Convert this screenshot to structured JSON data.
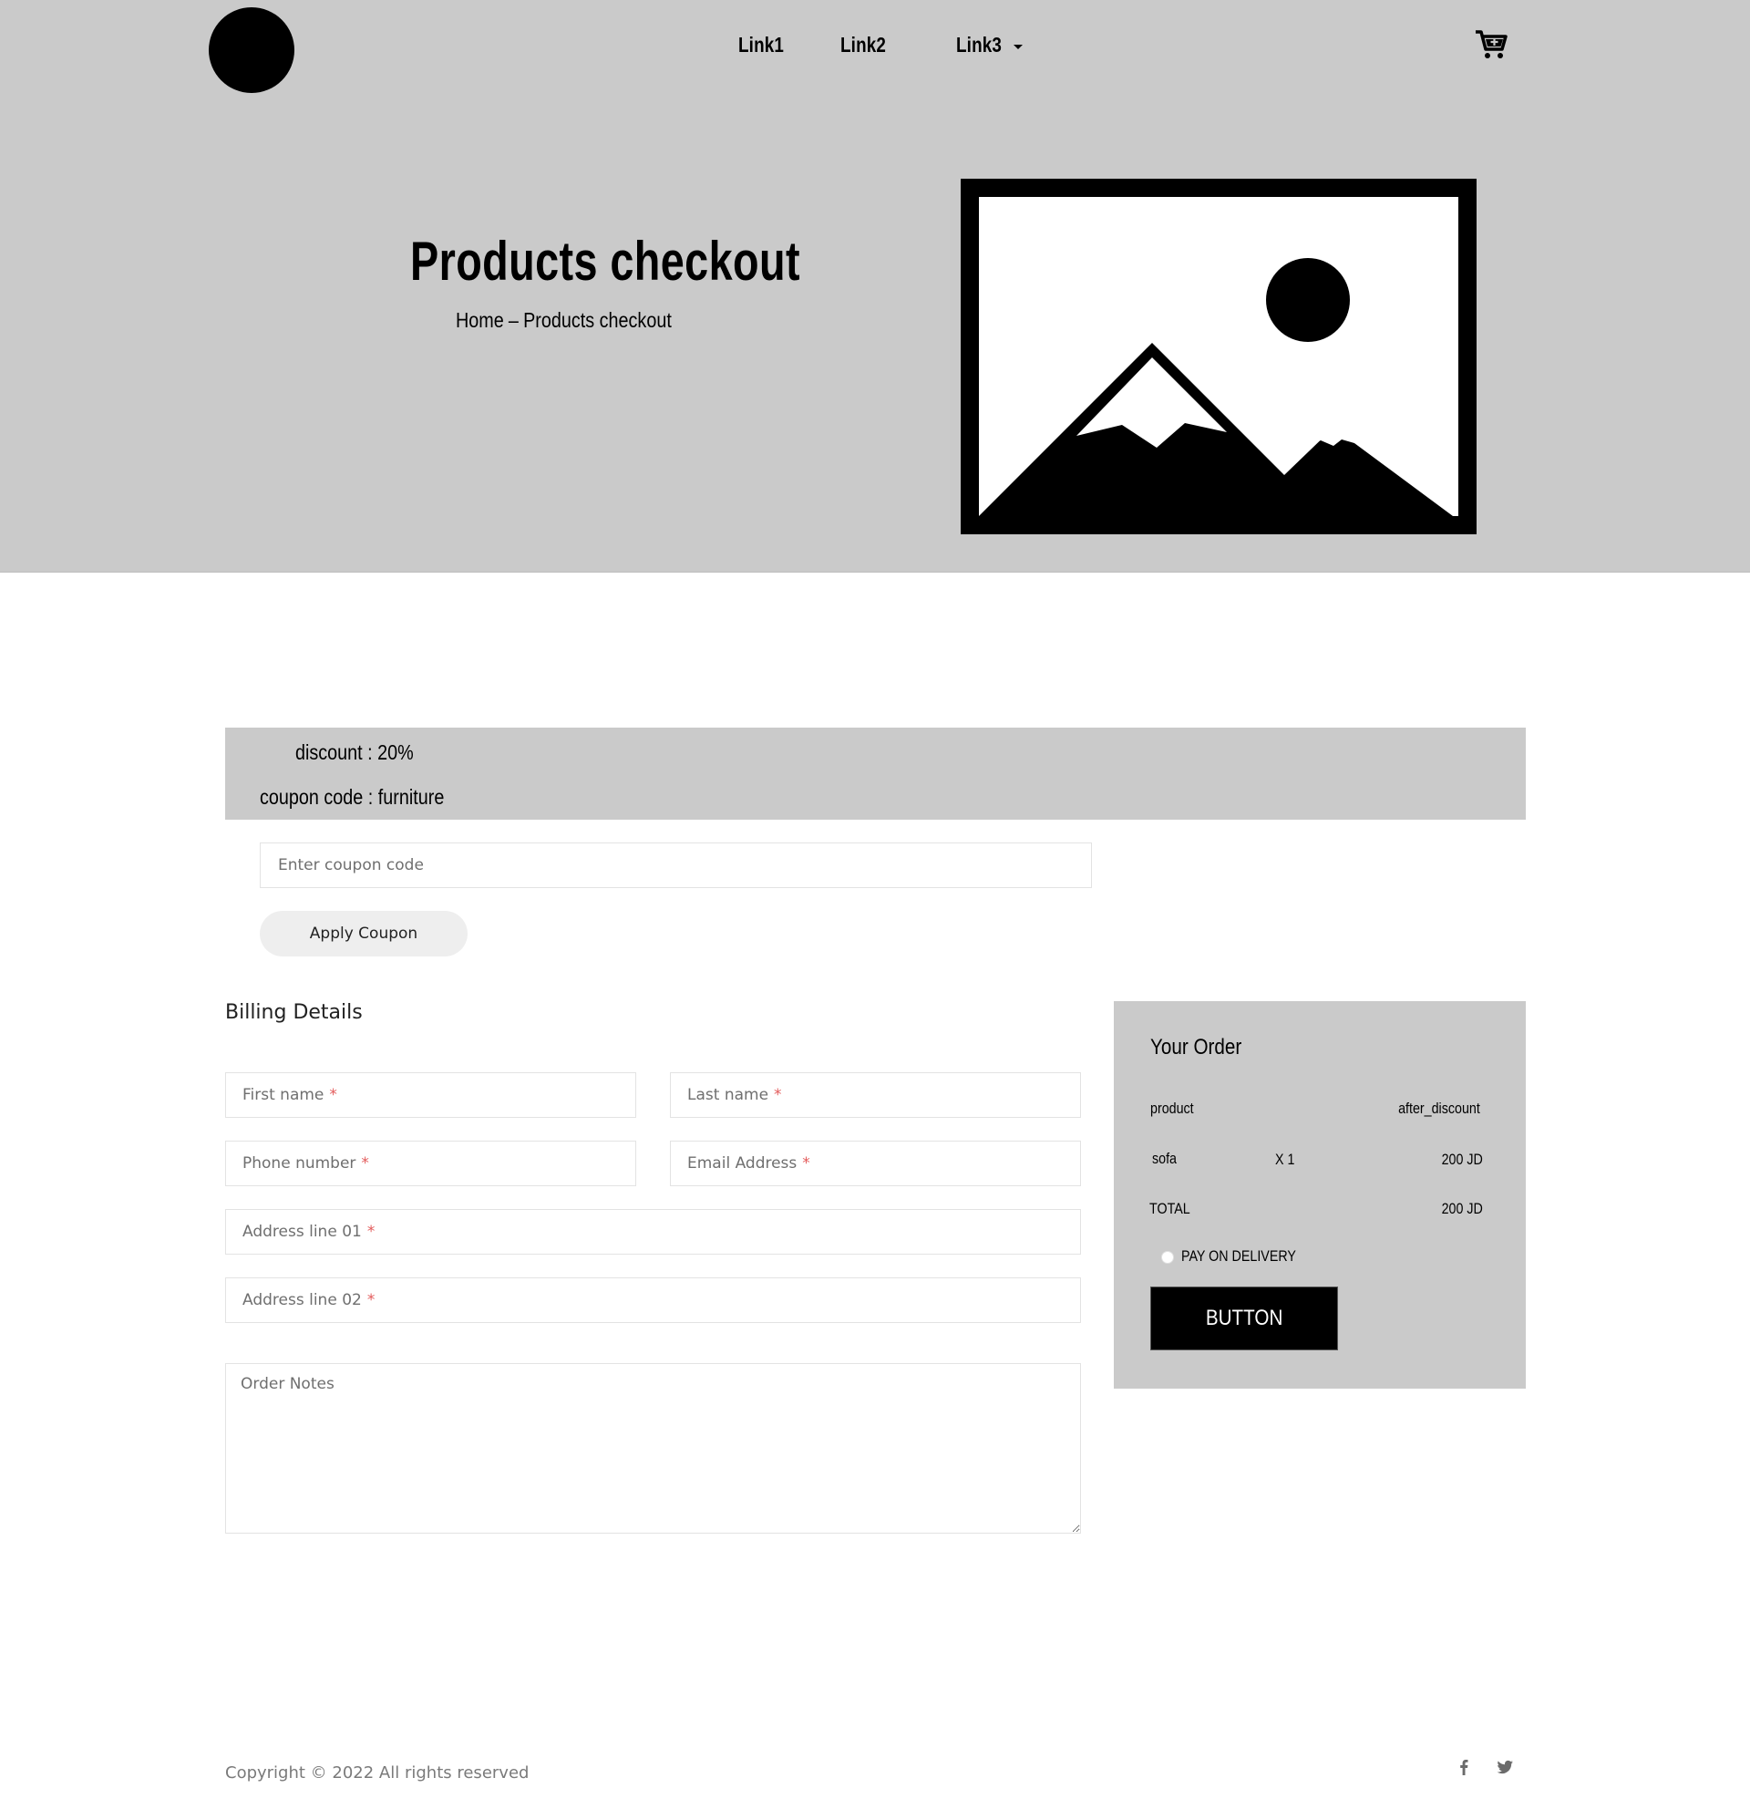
{
  "header": {
    "nav": [
      {
        "label": "Link1"
      },
      {
        "label": "Link2"
      },
      {
        "label": "Link3"
      }
    ],
    "cart_icon": "cart-plus-icon"
  },
  "hero": {
    "title": "Products checkout",
    "breadcrumb": {
      "home": "Home",
      "separator": "–",
      "current": "Products checkout"
    },
    "image_icon": "image-placeholder-icon"
  },
  "coupon": {
    "discount_label": "discount : 20%",
    "code_label": "coupon code : furniture",
    "input_placeholder": "Enter coupon code",
    "apply_label": "Apply Coupon"
  },
  "billing": {
    "title": "Billing Details",
    "fields": {
      "first_name": "First name",
      "last_name": "Last name",
      "phone": "Phone number",
      "email": "Email Address",
      "address1": "Address line 01",
      "address2": "Address line 02"
    },
    "required_mark": "*",
    "notes_placeholder": "Order Notes"
  },
  "order": {
    "title": "Your Order",
    "header_product": "product",
    "header_price": "after_discount",
    "item": {
      "name": "sofa",
      "qty": "X 1",
      "price": "200 JD"
    },
    "total_label": "TOTAL",
    "total_value": "200 JD",
    "payment_option": "PAY ON DELIVERY",
    "button_label": "BUTTON"
  },
  "footer": {
    "copyright": "Copyright © 2022 All rights reserved",
    "social": [
      "facebook-icon",
      "twitter-icon"
    ]
  },
  "colors": {
    "hero_bg": "#cacaca",
    "required": "#e35b5b",
    "button_bg": "#000000"
  }
}
